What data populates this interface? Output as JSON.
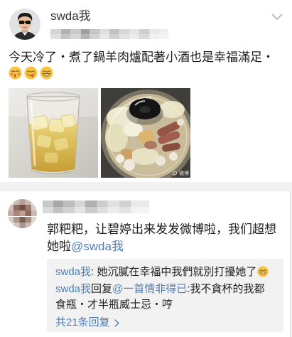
{
  "post": {
    "author": {
      "name": "swda我",
      "avatar_icon": "user-avatar-sunglasses-icon"
    },
    "menu_icon": "chevron-down-icon",
    "text": "今天冷了・煮了鍋羊肉爐配著小酒也是幸福滿足・",
    "emojis": [
      "kissing-face-icon",
      "yummy-face-icon",
      "grinning-face-icon"
    ],
    "photo_watermark": "微博"
  },
  "comment": {
    "avatar_icon": "pixelated-avatar-icon",
    "text": "郭粑粑，让碧婷出来发发微博啦，我们超想她啦",
    "mention": "@swda我",
    "replies": [
      {
        "author": "swda我",
        "text": ": 她沉膩在幸福中我們就別打擾她了",
        "emoji": "grinning-face-icon"
      },
      {
        "author": "swda我",
        "action": "回复",
        "mention": "@一首情非得已",
        "text_lines": [
          ":我不貪杯的我都",
          "食瓶・才半瓶威士忌・哼"
        ]
      }
    ],
    "more_replies": {
      "label": "共21条回复",
      "icon": "chevron-right-icon"
    }
  },
  "theme": {
    "link_color": "#4f7db8",
    "reply_bg": "#f2f2f2",
    "separator": "#f1f1f1"
  }
}
